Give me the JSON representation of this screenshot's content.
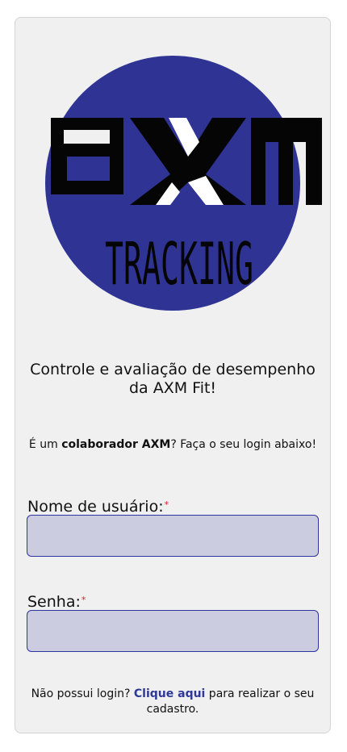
{
  "logo": {
    "brand": "axm",
    "subtitle": "TRACKING",
    "colors": {
      "circle": "#2f3494",
      "letters": "#050505",
      "x_highlight": "#ffffff"
    }
  },
  "tagline": "Controle e avaliação de desempenho da AXM Fit!",
  "intro": {
    "prefix": "É um ",
    "bold": "colaborador AXM",
    "suffix": "? Faça o seu login abaixo!"
  },
  "form": {
    "username_label": "Nome de usuário:",
    "username_value": "",
    "password_label": "Senha:",
    "password_value": "",
    "required_mark": "*"
  },
  "signup": {
    "prefix": "Não possui login? ",
    "link_text": "Clique aqui",
    "suffix": " para realizar o seu cadastro."
  },
  "colors": {
    "accent": "#2e3896",
    "input_bg": "#cbcce0",
    "input_border": "#2e34a0",
    "card_bg": "#f0f0f0",
    "required": "#d62020"
  }
}
